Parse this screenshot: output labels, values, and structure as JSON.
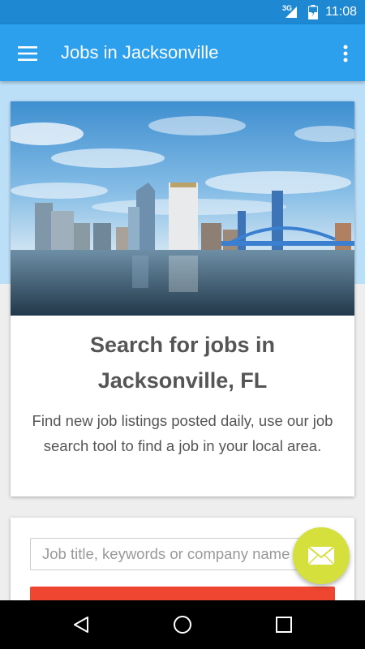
{
  "status_bar": {
    "network": "3G",
    "time": "11:08"
  },
  "app_bar": {
    "title": "Jobs in Jacksonville",
    "menu_icon": "hamburger-menu-icon",
    "more_icon": "more-vert-icon"
  },
  "hero": {
    "title": "Search for jobs in Jacksonville, FL",
    "description": "Find new job listings posted daily, use our job search tool to find a job in your local area."
  },
  "search": {
    "placeholder": "Job title, keywords or company name",
    "button_label": ""
  },
  "fab": {
    "icon": "mail-icon"
  },
  "colors": {
    "status_bar": "#1e88d2",
    "app_bar": "#2ca0ec",
    "band": "#bcdff8",
    "fab": "#d5e03d",
    "search_button": "#ef4632"
  },
  "nav": {
    "back_icon": "back-triangle-icon",
    "home_icon": "home-circle-icon",
    "recents_icon": "recents-square-icon"
  }
}
